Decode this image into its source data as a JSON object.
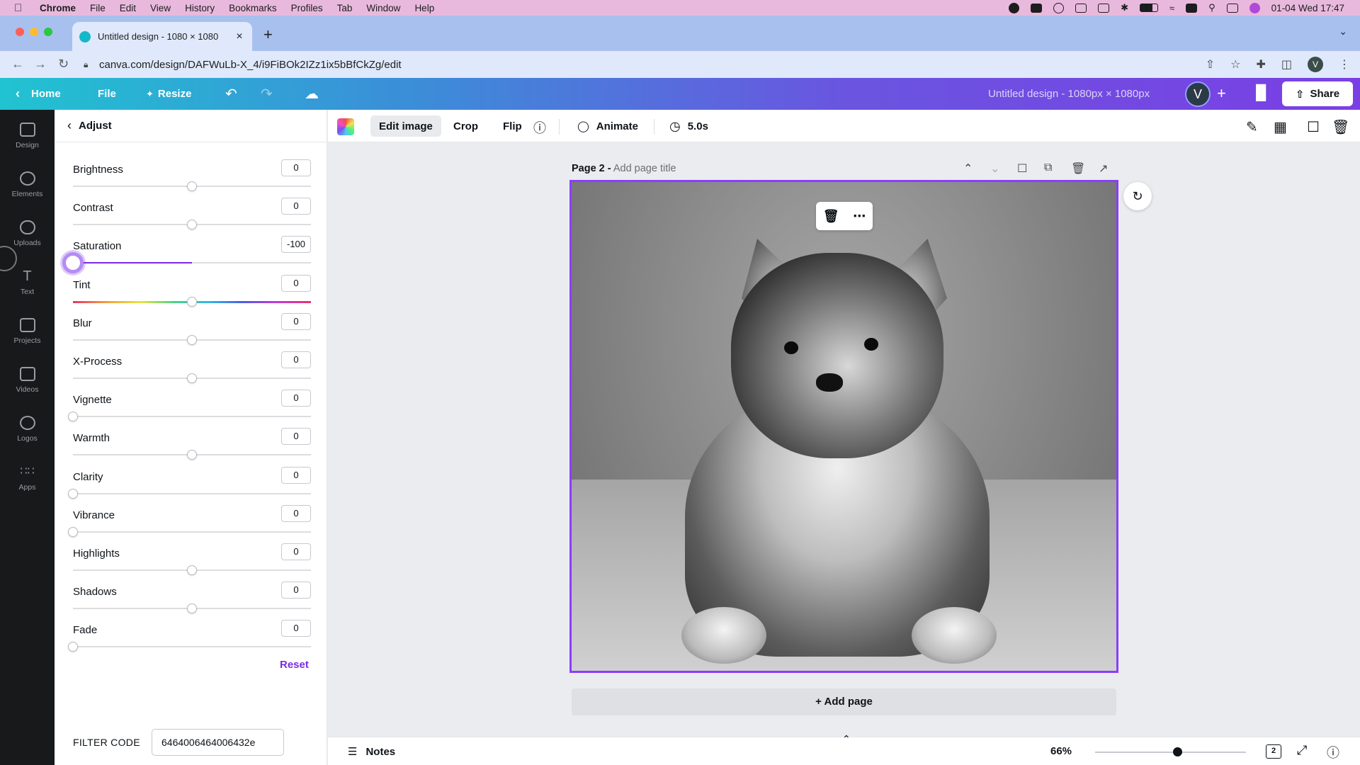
{
  "menubar": {
    "items": [
      "Chrome",
      "File",
      "Edit",
      "View",
      "History",
      "Bookmarks",
      "Profiles",
      "Tab",
      "Window",
      "Help"
    ],
    "datetime": "01-04 Wed  17:47"
  },
  "browser": {
    "tab_title": "Untitled design - 1080 × 1080",
    "new_tab": "+",
    "url": "canva.com/design/DAFWuLb-X_4/i9FiBOk2IZz1ix5bBfCkZg/edit",
    "profile_initial": "V"
  },
  "header": {
    "home": "Home",
    "file": "File",
    "resize": "Resize",
    "design_name": "Untitled design - 1080px × 1080px",
    "avatar_initial": "V",
    "share": "Share"
  },
  "rail": {
    "items": [
      "Design",
      "Elements",
      "Uploads",
      "Text",
      "Projects",
      "Videos",
      "Logos",
      "Apps"
    ]
  },
  "panel": {
    "title": "Adjust",
    "adjustments": [
      {
        "label": "Brightness",
        "value": "0",
        "level": 0
      },
      {
        "label": "Contrast",
        "value": "0",
        "level": 0
      },
      {
        "label": "Saturation",
        "value": "-100",
        "level": -100
      },
      {
        "label": "Tint",
        "value": "0",
        "level": 0
      },
      {
        "label": "Blur",
        "value": "0",
        "level": 0
      },
      {
        "label": "X-Process",
        "value": "0",
        "level": 0
      },
      {
        "label": "Vignette",
        "value": "0",
        "level": 0
      },
      {
        "label": "Warmth",
        "value": "0",
        "level": 0
      },
      {
        "label": "Clarity",
        "value": "0",
        "level": 0
      },
      {
        "label": "Vibrance",
        "value": "0",
        "level": 0
      },
      {
        "label": "Highlights",
        "value": "0",
        "level": 0
      },
      {
        "label": "Shadows",
        "value": "0",
        "level": 0
      },
      {
        "label": "Fade",
        "value": "0",
        "level": 0
      }
    ],
    "reset": "Reset",
    "filter_code_label": "FILTER CODE",
    "filter_code_value": "6464006464006432e"
  },
  "toolbar": {
    "edit_image": "Edit image",
    "crop": "Crop",
    "flip": "Flip",
    "animate": "Animate",
    "duration": "5.0s"
  },
  "canvas": {
    "page_number": "Page 2 -",
    "page_title_placeholder": "Add page title",
    "add_page": "+ Add page"
  },
  "footer": {
    "notes": "Notes",
    "zoom": "66%",
    "zoom_level": 0.66,
    "page_count": "2"
  },
  "colors": {
    "accent": "#7d2ae8",
    "selection": "#8b3dff",
    "rail_bg": "#18191b"
  }
}
